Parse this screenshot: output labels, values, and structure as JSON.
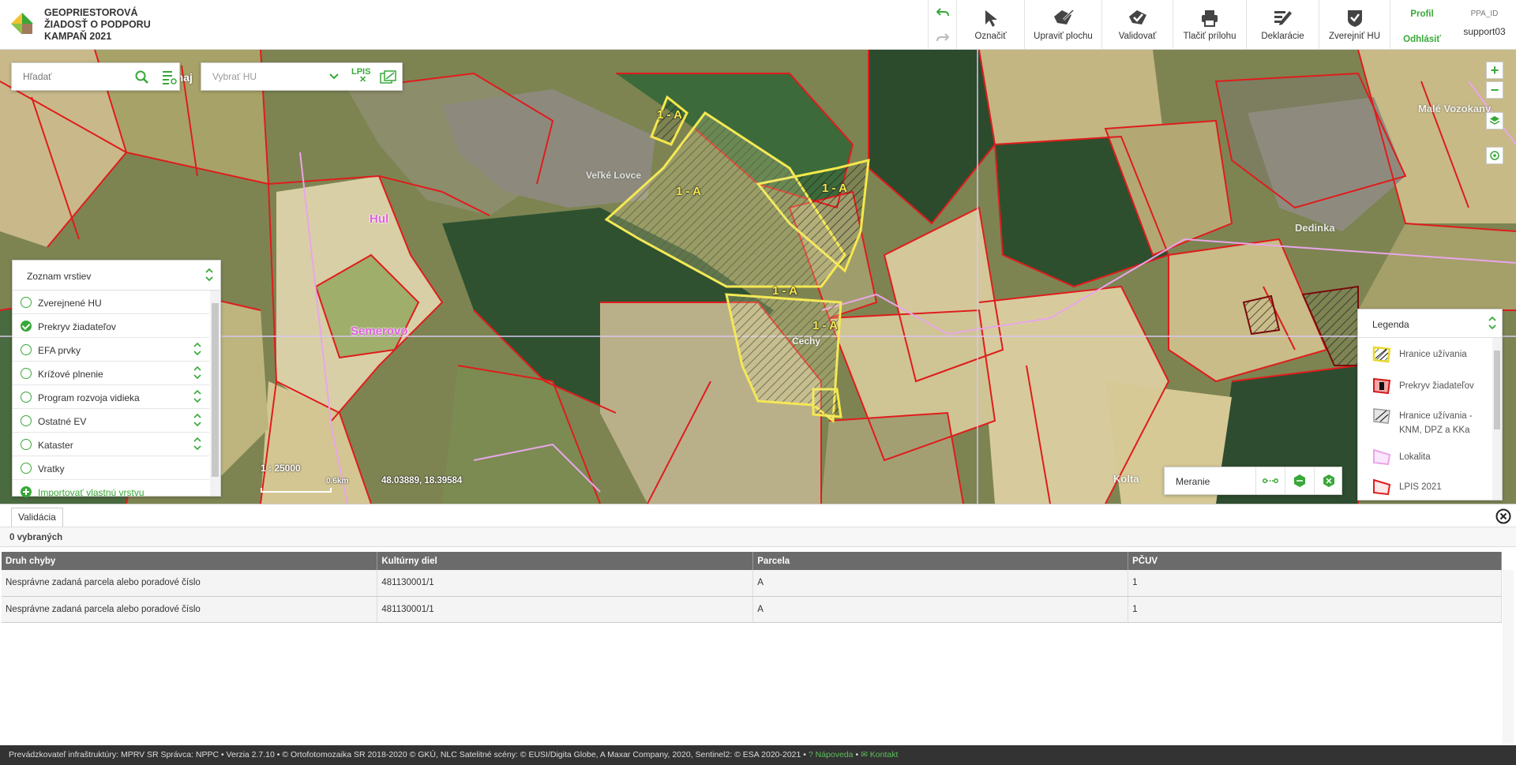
{
  "header": {
    "title_lines": [
      "GEOPRIESTOROVÁ",
      "ŽIADOSŤ O PODPORU",
      "KAMPAŇ 2021"
    ],
    "tools": [
      {
        "label": "Označiť",
        "icon": "cursor-icon"
      },
      {
        "label": "Upraviť plochu",
        "icon": "edit-shape-icon"
      },
      {
        "label": "Validovať",
        "icon": "validate-icon"
      },
      {
        "label": "Tlačiť prílohu",
        "icon": "print-icon"
      },
      {
        "label": "Deklarácie",
        "icon": "declarations-icon"
      },
      {
        "label": "Zverejniť HU",
        "icon": "publish-icon"
      }
    ],
    "profile_label": "Profil",
    "logout_label": "Odhlásiť",
    "user_id_label": "PPA_ID",
    "user_name": "support03"
  },
  "map": {
    "search": {
      "placeholder": "Hľadať"
    },
    "hu_select": {
      "placeholder": "Vybrať HU"
    },
    "lpis_label": "LPIS",
    "place_labels": {
      "dolny_ohaj": "Dolný Ohaj",
      "hul": "Hul",
      "semerovo": "Semerovo",
      "velke_lovce": "Veľké Lovce",
      "cechy": "Čechy",
      "dedinka": "Dedinka",
      "kolta": "Kolta",
      "mala_vozokany": "Malé Vozokany"
    },
    "parcel_label": "1 - A",
    "scale": "1 : 25000",
    "scale_unit": "0.6km",
    "coordinates": "48.03889, 18.39584",
    "layers": {
      "title": "Zoznam vrstiev",
      "items": [
        {
          "label": "Zverejnené HU",
          "checked": false,
          "reorder": false
        },
        {
          "label": "Prekryv žiadateľov",
          "checked": true,
          "reorder": false
        },
        {
          "label": "EFA prvky",
          "checked": false,
          "reorder": true
        },
        {
          "label": "Krížové plnenie",
          "checked": false,
          "reorder": true
        },
        {
          "label": "Program rozvoja vidieka",
          "checked": false,
          "reorder": true
        },
        {
          "label": "Ostatné EV",
          "checked": false,
          "reorder": true
        },
        {
          "label": "Kataster",
          "checked": false,
          "reorder": true
        },
        {
          "label": "Vratky",
          "checked": false,
          "reorder": false
        }
      ],
      "import_label": "Importovať vlastnú vrstvu"
    },
    "legend": {
      "title": "Legenda",
      "items": [
        {
          "label": "Hranice užívania",
          "icon": "usage-boundary-icon"
        },
        {
          "label": "Prekryv žiadateľov",
          "icon": "applicant-overlap-icon"
        },
        {
          "label": "Hranice užívania - KNM, DPZ a KKa",
          "icon": "usage-boundary-knm-icon"
        },
        {
          "label": "Lokalita",
          "icon": "locality-icon"
        },
        {
          "label": "LPIS 2021",
          "icon": "lpis-2021-icon"
        }
      ]
    },
    "measure": {
      "label": "Meranie"
    }
  },
  "validation": {
    "tab_label": "Validácia",
    "selected_count": "0 vybraných",
    "columns": [
      "Druh chyby",
      "Kultúrny diel",
      "Parcela",
      "PČUV"
    ],
    "rows": [
      [
        "Nesprávne zadaná parcela alebo poradové číslo",
        "481130001/1",
        "A",
        "1"
      ],
      [
        "Nesprávne zadaná parcela alebo poradové číslo",
        "481130001/1",
        "A",
        "1"
      ]
    ]
  },
  "footer": {
    "text": "Prevádzkovateľ infraštruktúry: MPRV SR Správca: NPPC • Verzia 2.7.10 • © Ortofotomozaika SR 2018-2020 © GKÚ, NLC Satelitné scény: © EUSI/Digita Globe, A Maxar Company, 2020, Sentinel2: © ESA 2020-2021 •",
    "help_label": "Nápoveda",
    "contact_label": "Kontakt",
    "sep": "•"
  },
  "colors": {
    "accent": "#38a838",
    "parcel_border": "#e01c1c",
    "usage_border": "#f5e84c",
    "header_bg": "#ffffff",
    "footer_bg": "#333333"
  }
}
